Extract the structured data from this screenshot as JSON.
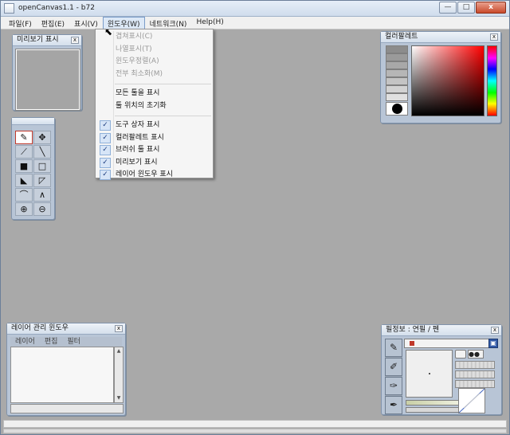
{
  "window": {
    "title": "openCanvas1.1 - b72",
    "controls": {
      "minimize": "—",
      "maximize": "□",
      "close": "x"
    }
  },
  "menubar": {
    "items": [
      {
        "label": "파일(F)"
      },
      {
        "label": "편집(E)"
      },
      {
        "label": "표시(V)"
      },
      {
        "label": "윈도우(W)",
        "active": true
      },
      {
        "label": "네트워크(N)"
      },
      {
        "label": "Help(H)"
      }
    ]
  },
  "window_menu": {
    "group1": [
      {
        "label": "겹쳐표시(C)",
        "disabled": true
      },
      {
        "label": "나열표시(T)",
        "disabled": true
      },
      {
        "label": "윈도우정렬(A)",
        "disabled": true
      },
      {
        "label": "전부 최소화(M)",
        "disabled": true
      }
    ],
    "group2": [
      {
        "label": "모든 툴을 표시"
      },
      {
        "label": "툴 위치의 초기화"
      }
    ],
    "group3": [
      {
        "label": "도구 상자 표시",
        "checked": true
      },
      {
        "label": "컬러팔레트 표시",
        "checked": true
      },
      {
        "label": "브러쉬 툴 표시",
        "checked": true
      },
      {
        "label": "미리보기 표시",
        "checked": true
      },
      {
        "label": "레이어 윈도우 표시",
        "checked": true
      }
    ],
    "check_glyph": "✓"
  },
  "preview_panel": {
    "title": "미리보기 표시",
    "close": "x"
  },
  "palette_panel": {
    "title": "컬러팔레트",
    "close": "x",
    "swatches": [
      "#8c8c8c",
      "#9a9a9a",
      "#a8a8a8",
      "#b6b6b6",
      "#c4c4c4",
      "#d2d2d2",
      "#e0e0e0"
    ],
    "current_color": "#000000"
  },
  "layer_panel": {
    "title": "레이어 관리 윈도우",
    "close": "x",
    "tabs": [
      "레이어",
      "편집",
      "필터"
    ]
  },
  "pen_panel": {
    "title": "필정보 : 연필  /  펜",
    "close": "x"
  },
  "toolbox": {
    "tools": [
      {
        "name": "pencil-tool-icon",
        "glyph": "✎",
        "selected": true
      },
      {
        "name": "move-tool-icon",
        "glyph": "✥"
      },
      {
        "name": "eyedropper-tool-icon",
        "glyph": "⟋"
      },
      {
        "name": "line-tool-icon",
        "glyph": "╲"
      },
      {
        "name": "fill-black-tool-icon",
        "glyph": "■"
      },
      {
        "name": "select-rect-tool-icon",
        "glyph": "□"
      },
      {
        "name": "lasso-fill-tool-icon",
        "glyph": "◣"
      },
      {
        "name": "lasso-tool-icon",
        "glyph": "◸"
      },
      {
        "name": "curve-tool-icon",
        "glyph": "⌒"
      },
      {
        "name": "polyline-tool-icon",
        "glyph": "∧"
      },
      {
        "name": "zoom-in-tool-icon",
        "glyph": "⊕"
      },
      {
        "name": "zoom-out-tool-icon",
        "glyph": "⊖"
      }
    ]
  }
}
